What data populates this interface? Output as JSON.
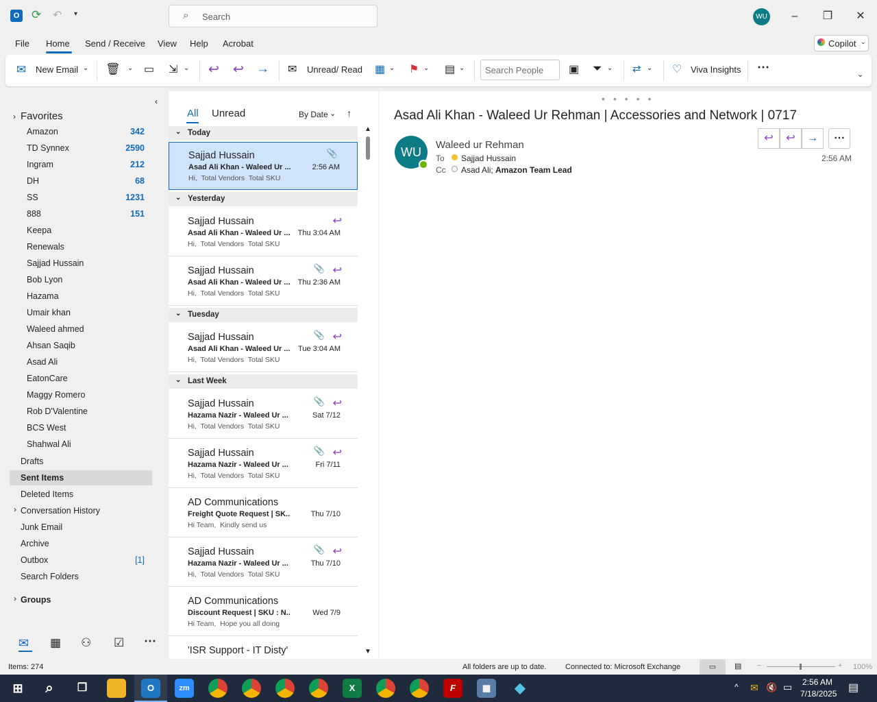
{
  "titlebar": {
    "search_placeholder": "Search",
    "avatar_initials": "WU"
  },
  "menu": {
    "items": [
      "File",
      "Home",
      "Send / Receive",
      "View",
      "Help",
      "Acrobat"
    ],
    "copilot_label": "Copilot"
  },
  "ribbon": {
    "new_email": "New Email",
    "unread_read": "Unread/ Read",
    "search_people_placeholder": "Search People",
    "viva_insights": "Viva Insights"
  },
  "folders": {
    "favorites_label": "Favorites",
    "items": [
      {
        "name": "Amazon",
        "count": "342"
      },
      {
        "name": "TD Synnex",
        "count": "2590"
      },
      {
        "name": "Ingram",
        "count": "212"
      },
      {
        "name": "DH",
        "count": "68"
      },
      {
        "name": "SS",
        "count": "1231"
      },
      {
        "name": "888",
        "count": "151"
      },
      {
        "name": "Keepa",
        "count": ""
      },
      {
        "name": "Renewals",
        "count": ""
      },
      {
        "name": "Sajjad Hussain",
        "count": ""
      },
      {
        "name": "Bob Lyon",
        "count": ""
      },
      {
        "name": "Hazama",
        "count": ""
      },
      {
        "name": "Umair khan",
        "count": ""
      },
      {
        "name": "Waleed ahmed",
        "count": ""
      },
      {
        "name": "Ahsan Saqib",
        "count": ""
      },
      {
        "name": "Asad Ali",
        "count": ""
      },
      {
        "name": "EatonCare",
        "count": ""
      },
      {
        "name": "Maggy Romero",
        "count": ""
      },
      {
        "name": "Rob D'Valentine",
        "count": ""
      },
      {
        "name": "BCS West",
        "count": ""
      },
      {
        "name": "Shahwal Ali",
        "count": ""
      }
    ],
    "top_items": [
      "Drafts",
      "Sent Items",
      "Deleted Items",
      "Conversation History",
      "Junk Email",
      "Archive",
      "Outbox",
      "Search Folders"
    ],
    "outbox_count": "[1]",
    "groups_label": "Groups"
  },
  "mail_list": {
    "tab_all": "All",
    "tab_unread": "Unread",
    "sort_label": "By Date",
    "groups": [
      "Today",
      "Yesterday",
      "Tuesday",
      "Last Week"
    ],
    "items": [
      {
        "sender": "Sajjad Hussain",
        "subject": "Asad Ali Khan - Waleed Ur ...",
        "preview": "Hi,  Total Vendors  Total SKU",
        "date": "2:56 AM"
      },
      {
        "sender": "Sajjad Hussain",
        "subject": "Asad Ali Khan - Waleed Ur ...",
        "preview": "Hi,  Total Vendors  Total SKU",
        "date": "Thu 3:04 AM"
      },
      {
        "sender": "Sajjad Hussain",
        "subject": "Asad Ali Khan - Waleed Ur ...",
        "preview": "Hi,  Total Vendors  Total SKU",
        "date": "Thu 2:36 AM"
      },
      {
        "sender": "Sajjad Hussain",
        "subject": "Asad Ali Khan - Waleed Ur ...",
        "preview": "Hi,  Total Vendors  Total SKU",
        "date": "Tue 3:04 AM"
      },
      {
        "sender": "Sajjad Hussain",
        "subject": "Hazama Nazir - Waleed Ur ...",
        "preview": "Hi,  Total Vendors  Total SKU",
        "date": "Sat 7/12"
      },
      {
        "sender": "Sajjad Hussain",
        "subject": "Hazama Nazir - Waleed Ur ...",
        "preview": "Hi,  Total Vendors  Total SKU",
        "date": "Fri 7/11"
      },
      {
        "sender": "AD Communications",
        "subject": "Freight Quote Request | SK...",
        "preview": "Hi Team,  Kindly send us",
        "date": "Thu 7/10"
      },
      {
        "sender": "Sajjad Hussain",
        "subject": "Hazama Nazir - Waleed Ur ...",
        "preview": "Hi,  Total Vendors  Total SKU",
        "date": "Thu 7/10"
      },
      {
        "sender": "AD Communications",
        "subject": "Discount Request | SKU : N...",
        "preview": "Hi Team,  Hope you all doing",
        "date": "Wed 7/9"
      },
      {
        "sender": "'ISR Support - IT Disty'",
        "subject": "",
        "preview": "",
        "date": ""
      }
    ]
  },
  "reading": {
    "subject": "Asad Ali Khan - Waleed Ur Rehman | Accessories and Network | 0717",
    "avatar_initials": "WU",
    "from": "Waleed ur Rehman",
    "to_label": "To",
    "to": "Sajjad Hussain",
    "cc_label": "Cc",
    "cc_name": "Asad Ali;",
    "cc_bold": "Amazon Team Lead",
    "time": "2:56 AM"
  },
  "status": {
    "items": "Items: 274",
    "sync": "All folders are up to date.",
    "connection": "Connected to: Microsoft Exchange",
    "zoom": "100%"
  },
  "taskbar": {
    "time": "2:56 AM",
    "date": "7/18/2025"
  }
}
